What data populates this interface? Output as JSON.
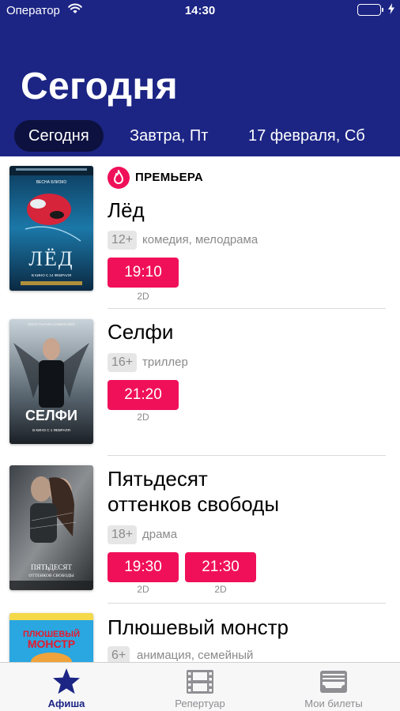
{
  "status_bar": {
    "carrier": "Оператор",
    "time": "14:30"
  },
  "header": {
    "title": "Сегодня",
    "date_tabs": [
      {
        "label": "Сегодня",
        "active": true
      },
      {
        "label": "Завтра, Пт",
        "active": false
      },
      {
        "label": "17 февраля, Сб",
        "active": false
      }
    ]
  },
  "movies": [
    {
      "badge": "ПРЕМЬЕРА",
      "title": "Лёд",
      "age": "12+",
      "genre": "комедия, мелодрама",
      "showtimes": [
        {
          "time": "19:10",
          "format": "2D"
        }
      ],
      "poster": {
        "top": "ВЕСНА БЛИЗКО",
        "main": "ЛЁД",
        "date": "В КИНО С 14 ФЕВРАЛЯ"
      }
    },
    {
      "title": "Селфи",
      "age": "16+",
      "genre": "триллер",
      "showtimes": [
        {
          "time": "21:20",
          "format": "2D"
        }
      ],
      "poster": {
        "top": "КОНСТАНТИН ХАБЕНСКИЙ",
        "main": "СЕЛФИ",
        "date": "В КИНО С 1 ФЕВРАЛЯ"
      }
    },
    {
      "title_line1": "Пятьдесят",
      "title_line2": "оттенков свободы",
      "age": "18+",
      "genre": "драма",
      "showtimes": [
        {
          "time": "19:30",
          "format": "2D"
        },
        {
          "time": "21:30",
          "format": "2D"
        }
      ],
      "poster": {
        "main1": "ПЯТЬДЕСЯТ",
        "main2": "ОТТЕНКОВ СВОБОДЫ"
      }
    },
    {
      "title": "Плюшевый монстр",
      "age": "6+",
      "genre": "анимация, семейный",
      "poster": {
        "main1": "ПЛЮШЕВЫЙ",
        "main2": "МОНСТР"
      }
    }
  ],
  "tab_bar": [
    {
      "label": "Афиша",
      "icon": "star-icon",
      "active": true
    },
    {
      "label": "Репертуар",
      "icon": "film-icon",
      "active": false
    },
    {
      "label": "Мои билеты",
      "icon": "tickets-icon",
      "active": false
    }
  ],
  "colors": {
    "header": "#1c2584",
    "active_tab_pill": "#0d113f",
    "accent": "#f0105a",
    "muted": "#8a8a8a"
  }
}
